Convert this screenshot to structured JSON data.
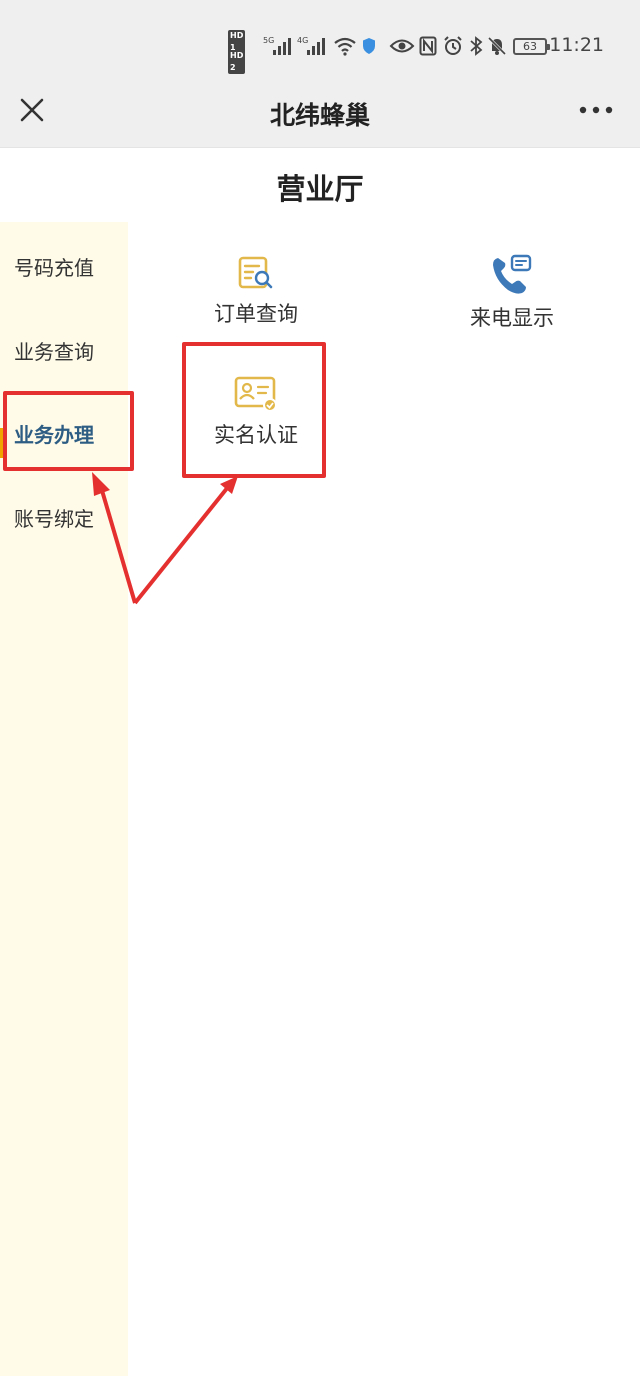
{
  "status_bar": {
    "hd1": "HD 1",
    "hd2": "HD 2",
    "net1": "5G",
    "net2": "4G",
    "battery": "63",
    "time": "11:21",
    "icons": [
      "signal-icon",
      "wifi-icon",
      "shield-icon",
      "eye-icon",
      "nfc-icon",
      "alarm-icon",
      "bluetooth-icon",
      "mute-bell-icon"
    ]
  },
  "title_bar": {
    "title": "北纬蜂巢",
    "close_icon": "close-icon",
    "more_icon": "more-icon"
  },
  "page": {
    "heading": "营业厅"
  },
  "sidebar": {
    "items": [
      {
        "label": "号码充值",
        "active": false
      },
      {
        "label": "业务查询",
        "active": false
      },
      {
        "label": "业务办理",
        "active": true
      },
      {
        "label": "账号绑定",
        "active": false
      }
    ]
  },
  "grid": {
    "items": [
      {
        "label": "订单查询",
        "icon": "order-search-icon"
      },
      {
        "label": "来电显示",
        "icon": "phone-display-icon"
      },
      {
        "label": "实名认证",
        "icon": "id-card-icon"
      }
    ]
  },
  "colors": {
    "accent": "#2e5d84",
    "sidebar_bg": "#fffbe8",
    "highlight": "#e53030",
    "icon_gold": "#e2b84a",
    "phone_blue": "#3d79b8"
  }
}
